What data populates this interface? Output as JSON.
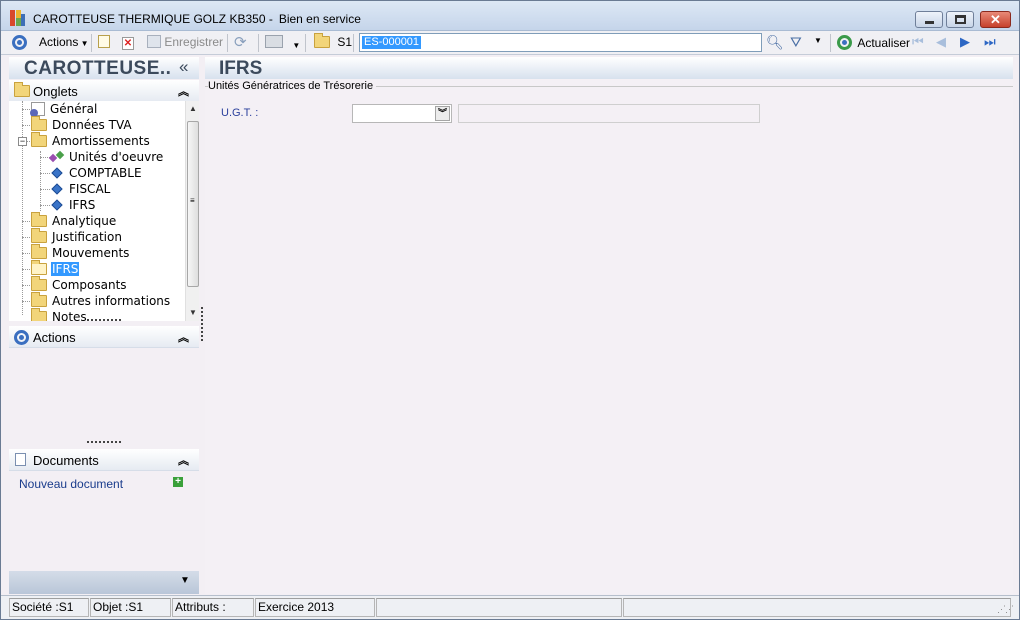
{
  "window": {
    "title": "CAROTTEUSE THERMIQUE GOLZ KB350 -",
    "subtitle": "Bien en service"
  },
  "toolbar": {
    "actions_label": "Actions",
    "save_label": "Enregistrer",
    "company_label": "S1",
    "search_value": "ES-000001",
    "refresh_label": "Actualiser"
  },
  "left_panel": {
    "header": "CAROTTEUSE..",
    "collapse_glyph": "«",
    "tabs_section": "Onglets",
    "actions_section": "Actions",
    "documents_section": "Documents",
    "new_document": "Nouveau document",
    "tree": [
      {
        "label": "Général"
      },
      {
        "label": "Données TVA"
      },
      {
        "label": "Amortissements"
      },
      {
        "label": "Unités d'oeuvre"
      },
      {
        "label": "COMPTABLE"
      },
      {
        "label": "FISCAL"
      },
      {
        "label": "IFRS"
      },
      {
        "label": "Analytique"
      },
      {
        "label": "Justification"
      },
      {
        "label": "Mouvements"
      },
      {
        "label": "IFRS"
      },
      {
        "label": "Composants"
      },
      {
        "label": "Autres informations"
      },
      {
        "label": "Notes"
      }
    ]
  },
  "content": {
    "title": "IFRS",
    "group_label": "Unités Génératrices de Trésorerie",
    "ugt_label": "U.G.T. :",
    "ugt_value": "",
    "ugt_description": ""
  },
  "statusbar": {
    "company": "Société :S1",
    "object": "Objet :S1",
    "attributes": "Attributs :",
    "fiscal_year": "Exercice 2013"
  }
}
